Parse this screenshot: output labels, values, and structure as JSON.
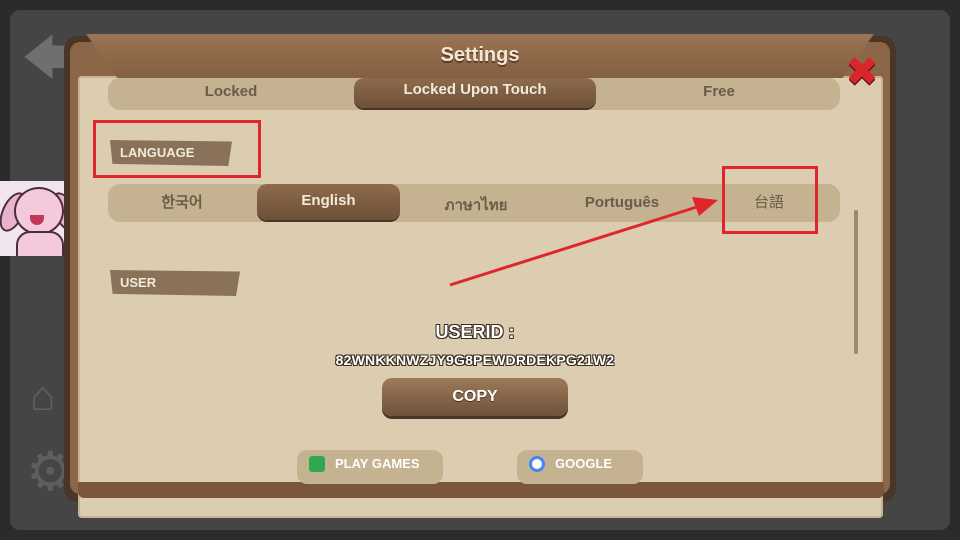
{
  "dialog": {
    "title": "Settings"
  },
  "controls": {
    "options": [
      "Locked",
      "Locked Upon Touch",
      "Free"
    ],
    "selected": "Locked Upon Touch"
  },
  "language": {
    "label": "LANGUAGE",
    "options": [
      "한국어",
      "English",
      "ภาษาไทย",
      "Português",
      "台語"
    ],
    "selected": "English",
    "highlighted": "台語"
  },
  "user": {
    "label": "USER",
    "userid_label": "USERID :",
    "userid_value": "82WNKKNWZJY9G8PEWDRDEKPG21W2",
    "copy_label": "COPY",
    "play_games_label": "PLAY GAMES",
    "google_label": "GOOGLE"
  },
  "icons": {
    "close": "close-icon",
    "back": "back-arrow-icon",
    "home": "home-icon",
    "gear": "gear-icon",
    "play_games": "play-games-icon",
    "google": "google-icon"
  },
  "colors": {
    "annotation_red": "#e0262c",
    "panel": "#dccdb1",
    "wood": "#8b6647"
  }
}
